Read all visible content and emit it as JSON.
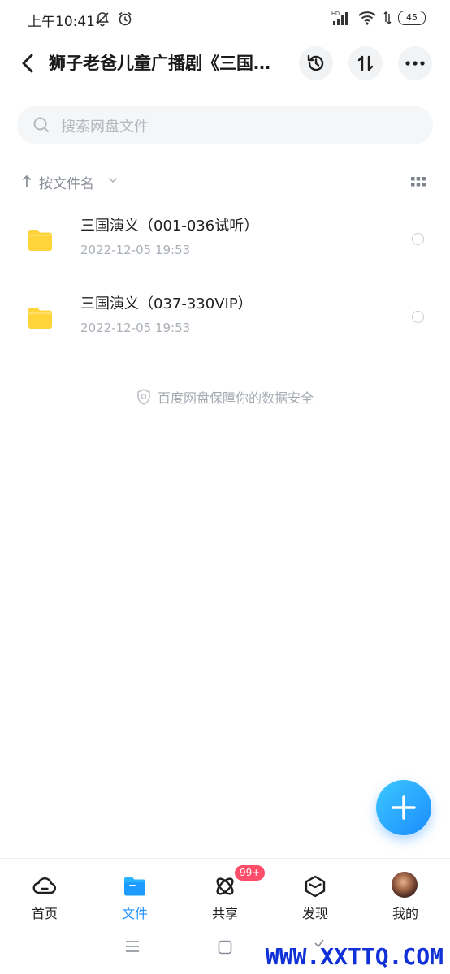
{
  "status_bar": {
    "time": "上午10:41",
    "battery": "45",
    "icons": [
      "bell-off-icon",
      "alarm-icon",
      "hd-signal-icon",
      "wifi-icon",
      "data-transfer-icon",
      "battery-icon"
    ],
    "hd_label": "HD"
  },
  "header": {
    "title": "狮子老爸儿童广播剧《三国演义》",
    "buttons": [
      "back-icon",
      "history-icon",
      "sort-transfer-icon",
      "more-icon"
    ]
  },
  "search": {
    "placeholder": "搜索网盘文件"
  },
  "sort": {
    "label": "按文件名"
  },
  "files": [
    {
      "name": "三国演义（001-036试听）",
      "date": "2022-12-05  19:53",
      "icon": "folder-icon"
    },
    {
      "name": "三国演义（037-330VIP）",
      "date": "2022-12-05  19:53",
      "icon": "folder-icon"
    }
  ],
  "security_note": "百度网盘保障你的数据安全",
  "bottom_nav": {
    "items": [
      {
        "label": "首页",
        "icon": "cloud-home-icon"
      },
      {
        "label": "文件",
        "icon": "folder-tab-icon"
      },
      {
        "label": "共享",
        "icon": "share-orbit-icon"
      },
      {
        "label": "发现",
        "icon": "discover-cube-icon"
      },
      {
        "label": "我的",
        "icon": "avatar"
      }
    ],
    "active_index": 1,
    "share_badge": "99+"
  },
  "watermark": "WWW.XXTTQ.COM",
  "colors": {
    "accent": "#1e8fff",
    "folder": "#ffd43b",
    "badge": "#ff4d6a",
    "watermark": "#1030d8"
  }
}
